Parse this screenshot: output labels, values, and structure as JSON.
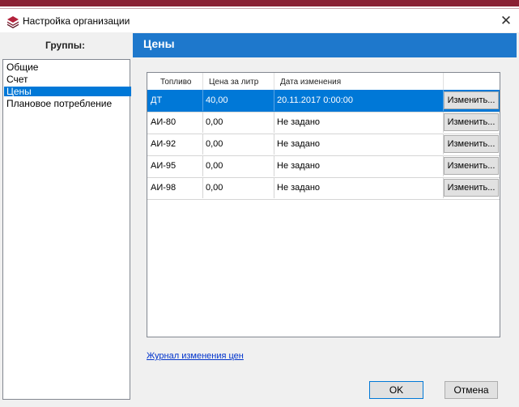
{
  "window": {
    "title": "Настройка организации",
    "close_symbol": "✕"
  },
  "sidebar": {
    "header": "Группы:",
    "items": [
      {
        "label": "Общие"
      },
      {
        "label": "Счет"
      },
      {
        "label": "Цены"
      },
      {
        "label": "Плановое потребление"
      }
    ]
  },
  "main": {
    "title": "Цены",
    "table": {
      "columns": [
        "Топливо",
        "Цена за литр",
        "Дата изменения"
      ],
      "rows": [
        {
          "fuel": "ДТ",
          "price": "40,00",
          "date": "20.11.2017 0:00:00",
          "action": "Изменить..."
        },
        {
          "fuel": "АИ-80",
          "price": "0,00",
          "date": "Не задано",
          "action": "Изменить..."
        },
        {
          "fuel": "АИ-92",
          "price": "0,00",
          "date": "Не задано",
          "action": "Изменить..."
        },
        {
          "fuel": "АИ-95",
          "price": "0,00",
          "date": "Не задано",
          "action": "Изменить..."
        },
        {
          "fuel": "АИ-98",
          "price": "0,00",
          "date": "Не задано",
          "action": "Изменить..."
        }
      ]
    },
    "history_link": "Журнал изменения цен"
  },
  "buttons": {
    "ok": "OK",
    "cancel": "Отмена"
  },
  "colors": {
    "accent": "#0078d7",
    "header": "#1e78cc",
    "top_stripe": "#8a1f33"
  }
}
